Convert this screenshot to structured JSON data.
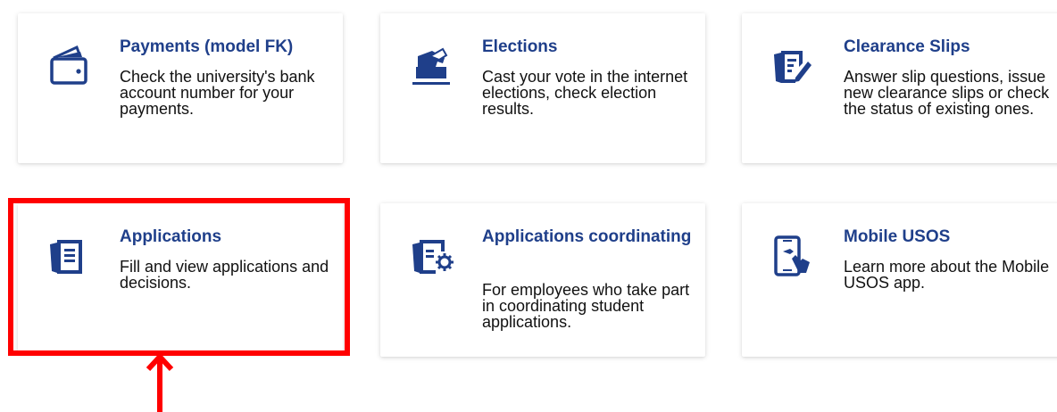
{
  "tiles": [
    {
      "id": "payments",
      "icon": "wallet-icon",
      "title": "Payments (model FK)",
      "description": "Check the university's bank account number for your payments."
    },
    {
      "id": "elections",
      "icon": "ballot-box-icon",
      "title": "Elections",
      "description": "Cast your vote in the internet elections, check election results."
    },
    {
      "id": "clearance-slips",
      "icon": "document-edit-icon",
      "title": "Clearance Slips",
      "description": "Answer slip questions, issue new clearance slips or check the status of existing ones."
    },
    {
      "id": "applications",
      "icon": "document-stack-icon",
      "title": "Applications",
      "description": "Fill and view applications and decisions."
    },
    {
      "id": "applications-coordinating",
      "icon": "document-gear-icon",
      "title": "Applications coordinating",
      "description": "For employees who take part in coordinating student applications."
    },
    {
      "id": "mobile-usos",
      "icon": "mobile-phone-tap-icon",
      "title": "Mobile USOS",
      "description": "Learn more about the Mobile USOS app."
    }
  ],
  "colors": {
    "title": "#1f3f8a",
    "icon": "#1f3f8a",
    "highlight": "#ff0000"
  }
}
